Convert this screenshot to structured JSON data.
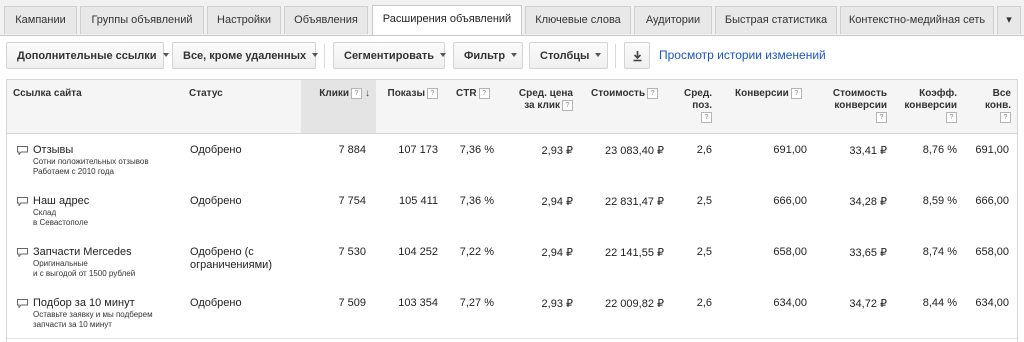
{
  "tabs": [
    {
      "label": "Кампании"
    },
    {
      "label": "Группы объявлений"
    },
    {
      "label": "Настройки"
    },
    {
      "label": "Объявления"
    },
    {
      "label": "Расширения объявлений"
    },
    {
      "label": "Ключевые слова"
    },
    {
      "label": "Аудитории"
    },
    {
      "label": "Быстрая статистика"
    },
    {
      "label": "Контекстно-медийная сеть"
    },
    {
      "label": "▾"
    }
  ],
  "toolbar": {
    "extension_type": "Дополнительные ссылки",
    "filter_status": "Все, кроме удаленных",
    "segment": "Сегментировать",
    "filter": "Фильтр",
    "columns": "Столбцы",
    "download_icon": "download-icon",
    "history_link": "Просмотр истории изменений"
  },
  "table": {
    "headers": {
      "link": "Ссылка сайта",
      "status": "Статус",
      "clicks": "Клики",
      "impressions": "Показы",
      "ctr": "CTR",
      "avg_cpc_1": "Сред. цена",
      "avg_cpc_2": "за клик",
      "cost": "Стоимость",
      "avg_pos_1": "Сред.",
      "avg_pos_2": "поз.",
      "conversions": "Конверсии",
      "cost_conv_1": "Стоимость",
      "cost_conv_2": "конверсии",
      "conv_rate_1": "Коэфф.",
      "conv_rate_2": "конверсии",
      "all_conv_1": "Все",
      "all_conv_2": "конв."
    },
    "help_glyph": "?",
    "sort_glyph": "↓",
    "rows": [
      {
        "title": "Отзывы",
        "line1": "Сотни положительных отзывов",
        "line2": "Работаем с 2010 года",
        "status": "Одобрено",
        "clicks": "7 884",
        "impressions": "107 173",
        "ctr": "7,36 %",
        "cpc": "2,93 ₽",
        "cost": "23 083,40 ₽",
        "pos": "2,6",
        "conversions": "691,00",
        "cost_conv": "33,41 ₽",
        "conv_rate": "8,76 %",
        "all_conv": "691,00"
      },
      {
        "title": "Наш адрес",
        "line1": "Склад",
        "line2": "в Севастополе",
        "status": "Одобрено",
        "clicks": "7 754",
        "impressions": "105 411",
        "ctr": "7,36 %",
        "cpc": "2,94 ₽",
        "cost": "22 831,47 ₽",
        "pos": "2,5",
        "conversions": "666,00",
        "cost_conv": "34,28 ₽",
        "conv_rate": "8,59 %",
        "all_conv": "666,00"
      },
      {
        "title": "Запчасти Mercedes",
        "line1": "Оригинальные",
        "line2": "и с выгодой от 1500 рублей",
        "status": "Одобрено (с ограничениями)",
        "clicks": "7 530",
        "impressions": "104 252",
        "ctr": "7,22 %",
        "cpc": "2,94 ₽",
        "cost": "22 141,55 ₽",
        "pos": "2,5",
        "conversions": "658,00",
        "cost_conv": "33,65 ₽",
        "conv_rate": "8,74 %",
        "all_conv": "658,00"
      },
      {
        "title": "Подбор за 10 минут",
        "line1": "Оставьте заявку и мы подберем",
        "line2": "запчасти за 10 минут",
        "status": "Одобрено",
        "clicks": "7 509",
        "impressions": "103 354",
        "ctr": "7,27 %",
        "cpc": "2,93 ₽",
        "cost": "22 009,82 ₽",
        "pos": "2,6",
        "conversions": "634,00",
        "cost_conv": "34,72 ₽",
        "conv_rate": "8,44 %",
        "all_conv": "634,00"
      }
    ]
  }
}
